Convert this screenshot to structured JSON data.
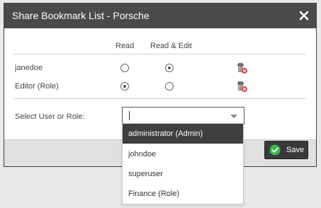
{
  "dialog": {
    "title": "Share Bookmark List - Porsche",
    "close_icon": "close-icon"
  },
  "permissions": {
    "columns": [
      "Read",
      "Read & Edit"
    ],
    "rows": [
      {
        "label": "janedoe",
        "read": false,
        "read_edit": true
      },
      {
        "label": "Editor (Role)",
        "read": true,
        "read_edit": false
      }
    ],
    "delete_icon": "trash-delete-icon"
  },
  "selector": {
    "label": "Select User or Role:",
    "value": "",
    "options": [
      "administrator (Admin)",
      "johndoe",
      "superuser",
      "Finance (Role)"
    ],
    "highlighted_index": 0
  },
  "footer": {
    "save_label": "Save",
    "save_icon": "check-circle-icon"
  },
  "colors": {
    "titlebar": "#4a4a4a",
    "highlight": "#3f3f3f",
    "save_check": "#3db54a",
    "delete_badge": "#e53935"
  }
}
